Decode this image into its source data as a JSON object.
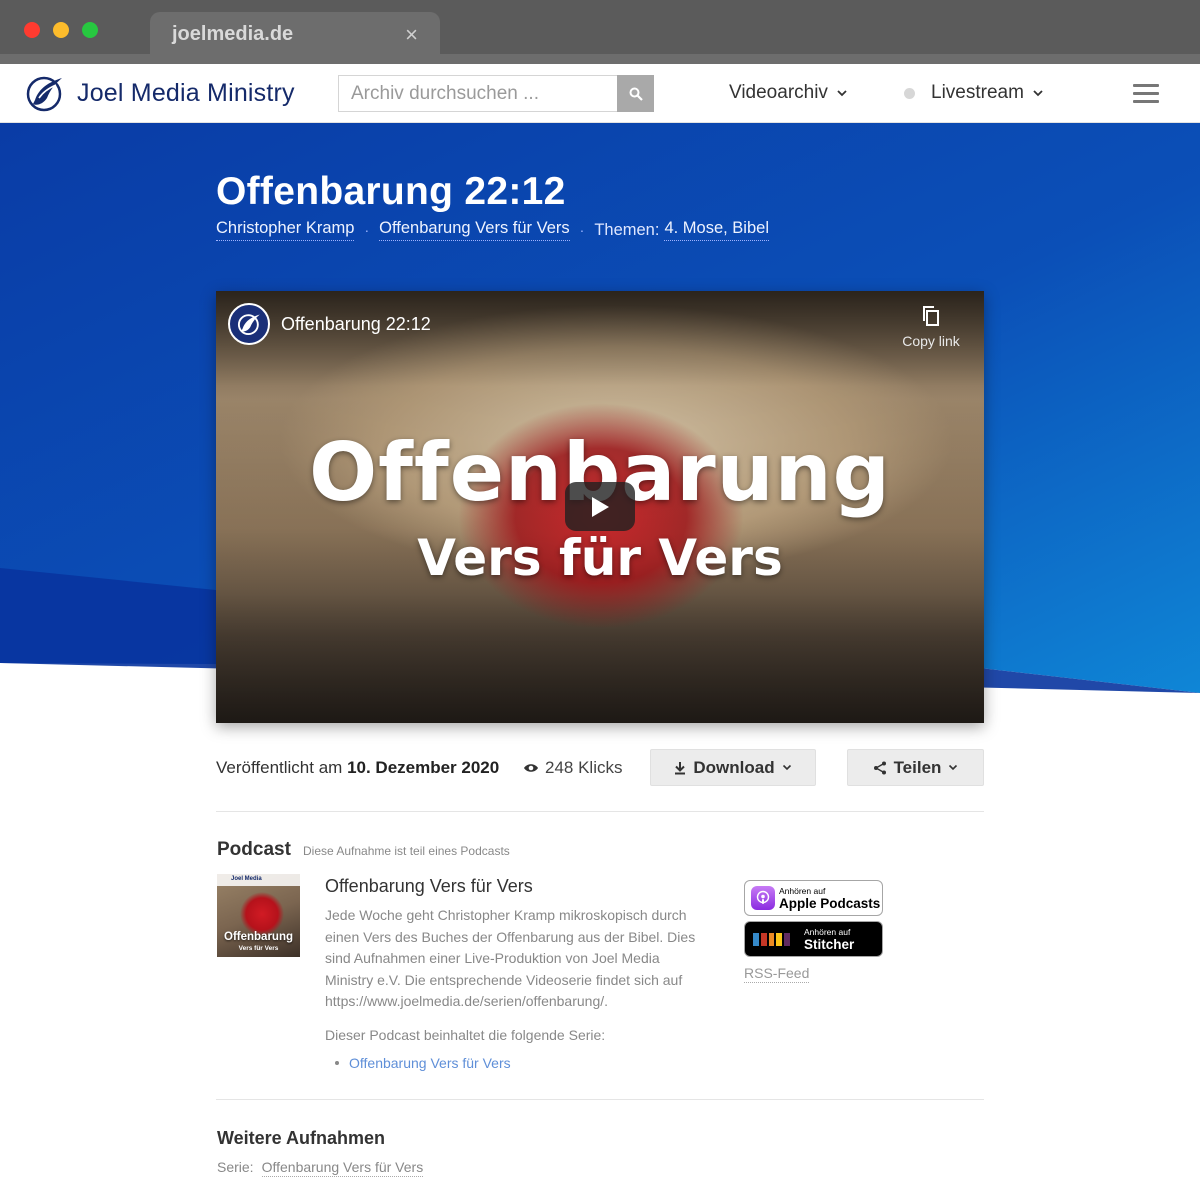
{
  "browser": {
    "tab_title": "joelmedia.de",
    "close_glyph": "×"
  },
  "header": {
    "logo_text": "Joel Media Ministry",
    "search_placeholder": "Archiv durchsuchen ...",
    "nav": {
      "videoarchiv": "Videoarchiv",
      "livestream": "Livestream"
    }
  },
  "hero": {
    "title": "Offenbarung 22:12",
    "author": "Christopher Kramp",
    "series": "Offenbarung Vers für Vers",
    "topics_label": "Themen:",
    "topics": "4. Mose, Bibel",
    "separator": "·"
  },
  "video": {
    "title": "Offenbarung 22:12",
    "copy_link": "Copy link",
    "thumb_title": "Offenbarung",
    "thumb_subtitle": "Vers für Vers"
  },
  "info": {
    "published_prefix": "Veröffentlicht am",
    "published_date": "10. Dezember 2020",
    "views": "248 Klicks",
    "download_label": "Download",
    "share_label": "Teilen"
  },
  "podcast": {
    "heading": "Podcast",
    "subheading": "Diese Aufnahme ist teil eines Podcasts",
    "cover_brand": "Joel Media",
    "cover_title": "Offenbarung",
    "cover_subtitle": "Vers für Vers",
    "title": "Offenbarung Vers für Vers",
    "description": "Jede Woche geht Christopher Kramp mikroskopisch durch einen Vers des Buches der Offenbarung aus der Bibel. Dies sind Aufnahmen einer Live-Produktion von Joel Media Ministry e.V. Die entsprechende Videoserie findet sich auf https://www.joelmedia.de/serien/offenbarung/.",
    "includes_label": "Dieser Podcast beinhaltet die folgende Serie:",
    "series_item": "Offenbarung Vers für Vers",
    "apple_small": "Anhören auf",
    "apple_big": "Apple Podcasts",
    "stitcher_small": "Anhören auf",
    "stitcher_big": "Stitcher",
    "rss_label": "RSS-Feed"
  },
  "more": {
    "heading": "Weitere Aufnahmen",
    "series_label": "Serie:",
    "series_link": "Offenbarung Vers für Vers"
  },
  "colors": {
    "hero_blue_dark": "#0b3ea8",
    "hero_blue_light": "#0f7fd3",
    "brand_navy": "#152a6a",
    "link_blue": "#5f8fd8"
  }
}
